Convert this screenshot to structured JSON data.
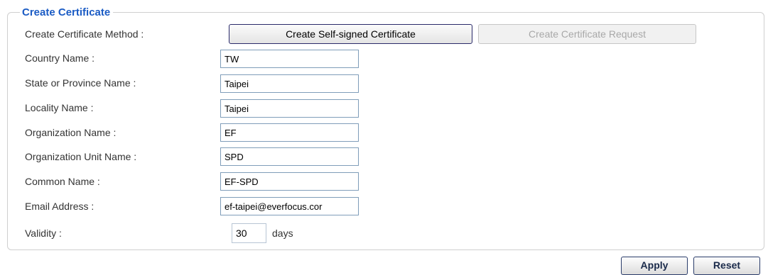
{
  "section": {
    "legend": "Create Certificate",
    "method": {
      "label": "Create Certificate Method :",
      "self_signed_label": "Create Self-signed Certificate",
      "request_label": "Create Certificate Request"
    },
    "fields": {
      "country": {
        "label": "Country Name :",
        "value": "TW"
      },
      "state": {
        "label": "State or Province Name :",
        "value": "Taipei"
      },
      "locality": {
        "label": "Locality Name :",
        "value": "Taipei"
      },
      "organization": {
        "label": "Organization Name :",
        "value": "EF"
      },
      "org_unit": {
        "label": "Organization Unit Name :",
        "value": "SPD"
      },
      "common_name": {
        "label": "Common Name :",
        "value": "EF-SPD"
      },
      "email": {
        "label": "Email Address :",
        "value": "ef-taipei@everfocus.cor"
      }
    },
    "validity": {
      "label": "Validity :",
      "value": "30",
      "unit": "days"
    }
  },
  "actions": {
    "apply_label": "Apply",
    "reset_label": "Reset"
  },
  "colors": {
    "legend": "#1a5bc4",
    "input_border": "#7f9db9"
  }
}
